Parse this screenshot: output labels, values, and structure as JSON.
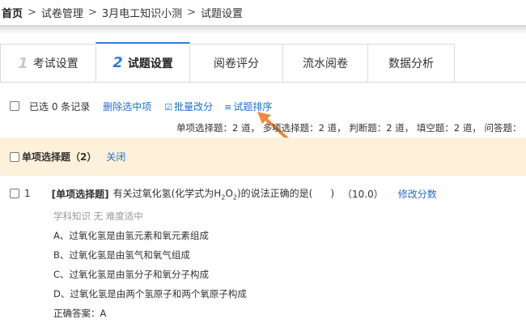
{
  "breadcrumb": {
    "home": "首页",
    "sep": ">",
    "items": [
      "试卷管理",
      "3月电工知识小测",
      "试题设置"
    ]
  },
  "tabs": [
    {
      "num": "1",
      "label": "考试设置"
    },
    {
      "num": "2",
      "label": "试题设置",
      "active": true
    },
    {
      "label": "阅卷评分"
    },
    {
      "label": "流水阅卷"
    },
    {
      "label": "数据分析"
    }
  ],
  "toolbar": {
    "selected_text": "已选 0 条记录",
    "delete_label": "删除选中项",
    "batch_label": "批量改分",
    "sort_label": "试题排序"
  },
  "summary": "单项选择题：2 道， 多项选择题：2 道， 判断题：2 道， 填空题：2 道， 问答题：",
  "section": {
    "title": "单项选择题（2）",
    "close_label": "关闭"
  },
  "question": {
    "number": "1",
    "type_tag": "[单项选择题]",
    "text_before": "有关过氧化氢(化学式为H",
    "sub1": "2",
    "text_mid": "O",
    "sub2": "2",
    "text_after": ")的说法正确的是(",
    "paren_close": ")",
    "score": "（10.0）",
    "edit_label": "修改分数",
    "meta": "学科知识  无   难度适中",
    "options": [
      "A、过氧化氢是由氢元素和氧元素组成",
      "B、过氧化氢是由氢气和氧气组成",
      "C、过氧化氢是由氢分子和氧分子构成",
      "D、过氧化氢是由两个氢原子和两个氧原子构成"
    ],
    "answer": "正确答案：A"
  },
  "colors": {
    "accent": "#2b7fd6",
    "link": "#1f6fd1",
    "section_bg": "#fdf1d9",
    "arrow": "#f0893a"
  },
  "icons": {
    "batch": "edit-square-icon",
    "sort": "list-lines-icon"
  }
}
